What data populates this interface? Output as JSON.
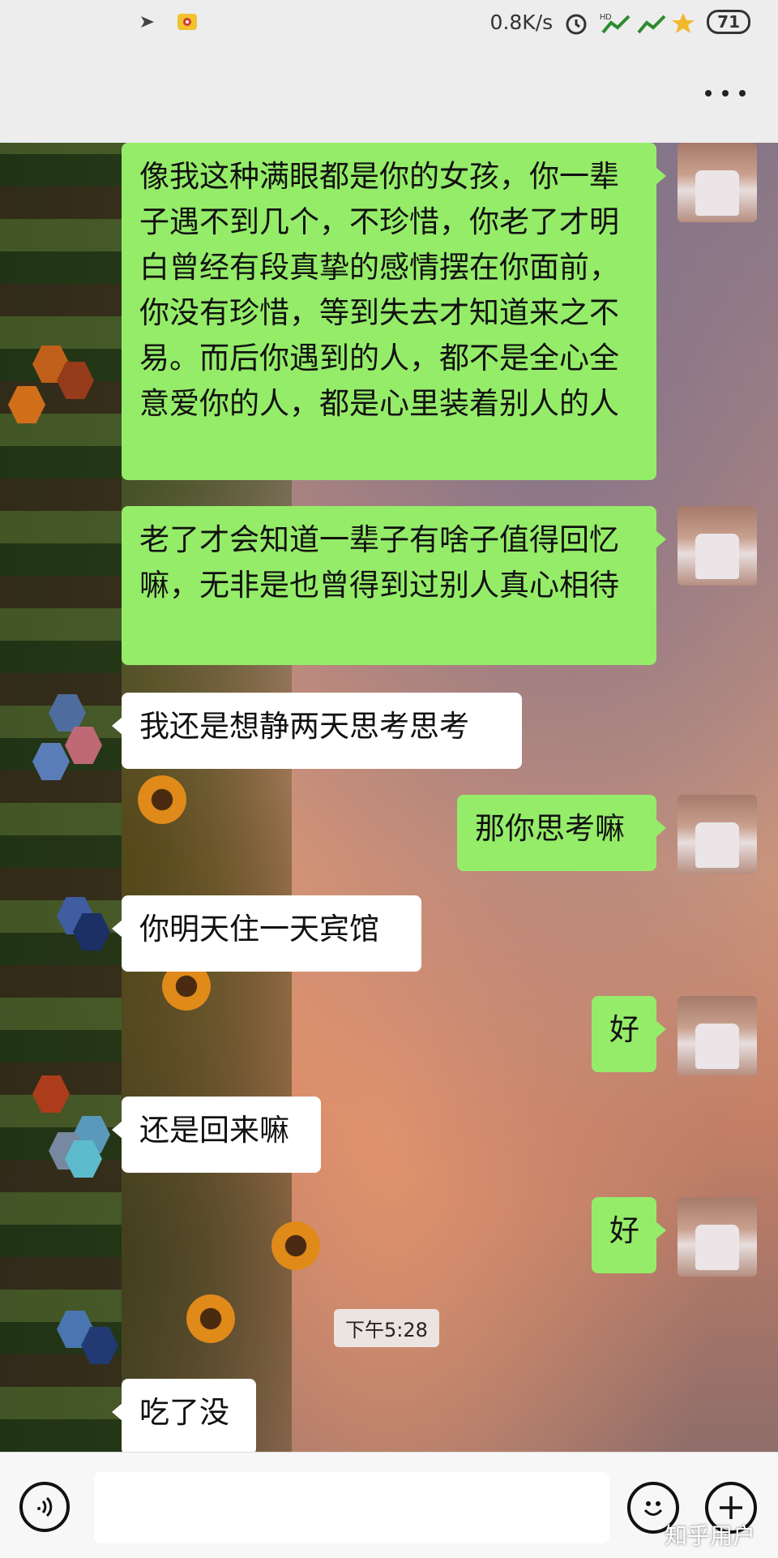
{
  "status_bar": {
    "network_speed": "0.8K/s",
    "battery_level": "71",
    "icons": [
      "arrow-icon",
      "eye-app-icon",
      "alarm-icon",
      "hd-signal-icon",
      "signal-icon",
      "star-icon",
      "battery-icon"
    ]
  },
  "header": {
    "more_icon": "more-dots-icon"
  },
  "messages": [
    {
      "side": "mine",
      "text": "像我这种满眼都是你的女孩，你一辈子遇不到几个，不珍惜，你老了才明白曾经有段真挚的感情摆在你面前，你没有珍惜，等到失去才知道来之不易。而后你遇到的人，都不是全心全意爱你的人，都是心里装着别人的人"
    },
    {
      "side": "mine",
      "text": "老了才会知道一辈子有啥子值得回忆嘛，无非是也曾得到过别人真心相待"
    },
    {
      "side": "theirs",
      "text": "我还是想静两天思考思考"
    },
    {
      "side": "mine",
      "text": "那你思考嘛"
    },
    {
      "side": "theirs",
      "text": "你明天住一天宾馆"
    },
    {
      "side": "mine",
      "text": "好"
    },
    {
      "side": "theirs",
      "text": "还是回来嘛"
    },
    {
      "side": "mine",
      "text": "好"
    },
    {
      "side": "theirs",
      "text": "吃了没"
    }
  ],
  "timestamp": "下午5:28",
  "input_bar": {
    "voice_icon": "voice-icon",
    "emoji_icon": "emoji-icon",
    "plus_icon": "plus-icon"
  },
  "watermark": "知乎用户",
  "colors": {
    "mine_bubble": "#95ec69",
    "theirs_bubble": "#ffffff",
    "bar_background": "#ededed"
  }
}
